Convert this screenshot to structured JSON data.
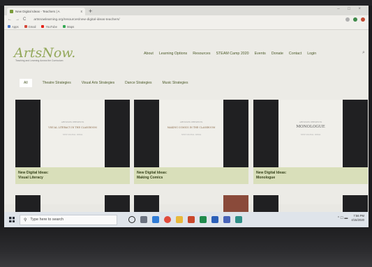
{
  "browser": {
    "tab_title": "New Digital Ideas - Teachers | A",
    "tab_close": "x",
    "new_tab": "+",
    "url": "artsnowlearning.org/resources/new-digital-ideas-teachers/",
    "back": "←",
    "forward": "→",
    "reload": "C",
    "window_controls": "– □ ×",
    "bookmarks": [
      {
        "label": "Apps",
        "color": "#4a76c8"
      },
      {
        "label": "Gmail",
        "color": "#d44638"
      },
      {
        "label": "YouTube",
        "color": "#e62117"
      },
      {
        "label": "Maps",
        "color": "#34a853"
      }
    ]
  },
  "site": {
    "logo": "ArtsNow.",
    "tagline": "Teaching and Learning Across the Curriculum",
    "nav": [
      "About",
      "Learning Options",
      "Resources",
      "STEAM Camp 2020",
      "Events",
      "Donate",
      "Contact",
      "Login"
    ],
    "search_glyph": "⌕",
    "filters": [
      "All",
      "Theatre Strategies",
      "Visual Arts Strategies",
      "Dance Strategies",
      "Music Strategies"
    ],
    "cards": [
      {
        "topline": "ARTSNOW PRESENTS",
        "heading": "VISUAL LITERACY IN THE CLASSROOM",
        "subline": "NEW DIGITAL IDEAS",
        "caption_1": "New Digital Ideas:",
        "caption_2": "Visual Literacy"
      },
      {
        "topline": "ARTSNOW PRESENTS",
        "heading": "MAKING COMICS IN THE CLASSROOM",
        "subline": "NEW DIGITAL IDEAS",
        "caption_1": "New Digital Ideas:",
        "caption_2": "Making Comics"
      },
      {
        "topline": "ARTSNOW PRESENTS",
        "heading": "MONOLOGUE",
        "subline": "NEW DIGITAL IDEAS",
        "caption_1": "New Digital Ideas:",
        "caption_2": "Monologue"
      }
    ]
  },
  "taskbar": {
    "search_placeholder": "Type here to search",
    "search_glyph": "⚲",
    "apps": [
      {
        "name": "cortana",
        "color": "#222222"
      },
      {
        "name": "task-view",
        "color": "#6b7280"
      },
      {
        "name": "edge",
        "color": "#2f7bd6"
      },
      {
        "name": "chrome",
        "color": "#e04b3c"
      },
      {
        "name": "file-explorer",
        "color": "#e8b93c"
      },
      {
        "name": "powerpoint",
        "color": "#c9472b"
      },
      {
        "name": "excel",
        "color": "#1f8a4c"
      },
      {
        "name": "word",
        "color": "#2b5fb8"
      },
      {
        "name": "outlook",
        "color": "#4863b8"
      },
      {
        "name": "publisher",
        "color": "#2e8e86"
      }
    ],
    "tray": "^ ☐ ▬",
    "time": "7:56 PM",
    "date": "4/15/2020"
  }
}
